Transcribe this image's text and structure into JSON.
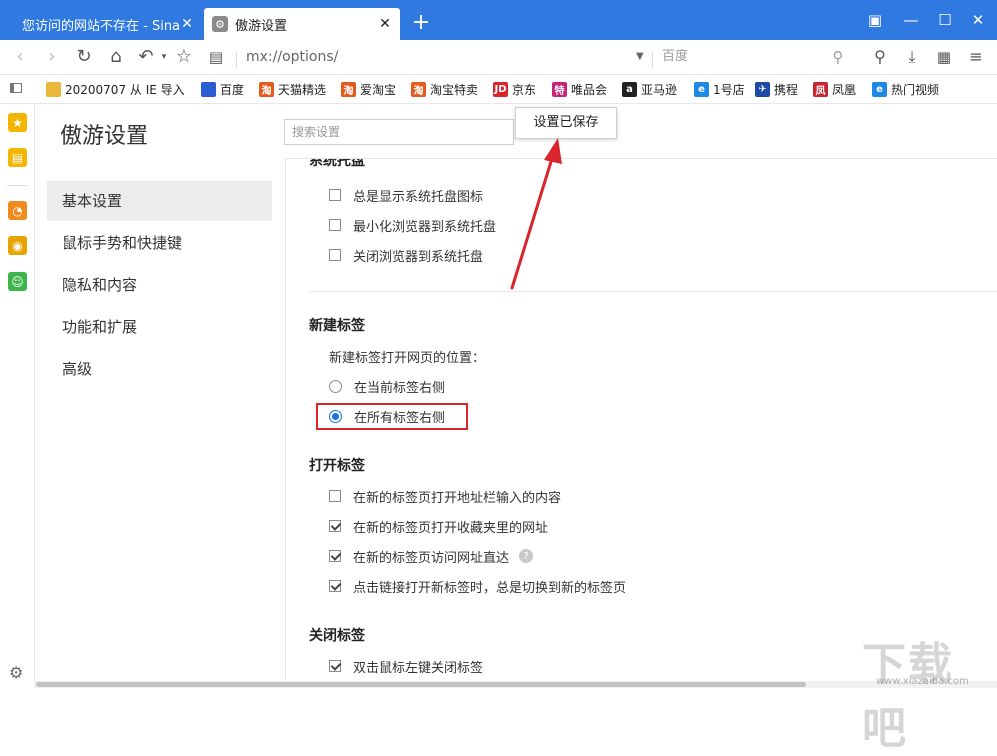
{
  "window": {
    "tabs": [
      {
        "label": "您访问的网站不存在 - Sina A"
      },
      {
        "label": "傲游设置"
      }
    ]
  },
  "navbar": {
    "address": "mx://options/",
    "search_placeholder": "百度"
  },
  "bookmarks": [
    {
      "label": "20200707 从 IE 导入",
      "icon": "folder-icon",
      "color": "#e9b83a"
    },
    {
      "label": "百度",
      "icon": "baidu-icon",
      "color": "#2f5bd3"
    },
    {
      "label": "天猫精选",
      "icon": "taobao-icon",
      "color": "#e35b1c"
    },
    {
      "label": "爱淘宝",
      "icon": "taobao-icon",
      "color": "#e35b1c"
    },
    {
      "label": "淘宝特卖",
      "icon": "taobao-icon",
      "color": "#e35b1c"
    },
    {
      "label": "京东",
      "icon": "jd-icon",
      "color": "#d9252b"
    },
    {
      "label": "唯品会",
      "icon": "vip-icon",
      "color": "#c7247a"
    },
    {
      "label": "亚马逊",
      "icon": "amazon-icon",
      "color": "#222222"
    },
    {
      "label": "1号店",
      "icon": "ie-icon",
      "color": "#1e88e5"
    },
    {
      "label": "携程",
      "icon": "ctrip-icon",
      "color": "#1c4aa6"
    },
    {
      "label": "凤凰",
      "icon": "phoenix-icon",
      "color": "#c8262e"
    },
    {
      "label": "热门视频",
      "icon": "ie-icon",
      "color": "#1e88e5"
    }
  ],
  "settings": {
    "title": "傲游设置",
    "search_placeholder": "搜索设置",
    "toast": "设置已保存",
    "nav": [
      "基本设置",
      "鼠标手势和快捷键",
      "隐私和内容",
      "功能和扩展",
      "高级"
    ],
    "tray_section_partial": "系统托盘",
    "tray_options": [
      {
        "label": "总是显示系统托盘图标",
        "checked": false
      },
      {
        "label": "最小化浏览器到系统托盘",
        "checked": false
      },
      {
        "label": "关闭浏览器到系统托盘",
        "checked": false
      }
    ],
    "newtab": {
      "title": "新建标签",
      "prompt": "新建标签打开网页的位置：",
      "options": [
        {
          "label": "在当前标签右侧",
          "selected": false
        },
        {
          "label": "在所有标签右侧",
          "selected": true
        }
      ]
    },
    "opentab": {
      "title": "打开标签",
      "options": [
        {
          "label": "在新的标签页打开地址栏输入的内容",
          "checked": false
        },
        {
          "label": "在新的标签页打开收藏夹里的网址",
          "checked": true
        },
        {
          "label": "在新的标签页访问网址直达",
          "checked": true,
          "help": "?"
        },
        {
          "label": "点击链接打开新标签时，总是切换到新的标签页",
          "checked": true
        }
      ]
    },
    "closetab": {
      "title": "关闭标签",
      "options": [
        {
          "label": "双击鼠标左键关闭标签",
          "checked": true
        }
      ]
    }
  },
  "watermark": {
    "main": "下载吧",
    "sub": "www.xiazaiba.com"
  },
  "colors": {
    "titlebar": "#2f79e0",
    "highlight": "#d9252b",
    "accent": "#1a73e8"
  }
}
